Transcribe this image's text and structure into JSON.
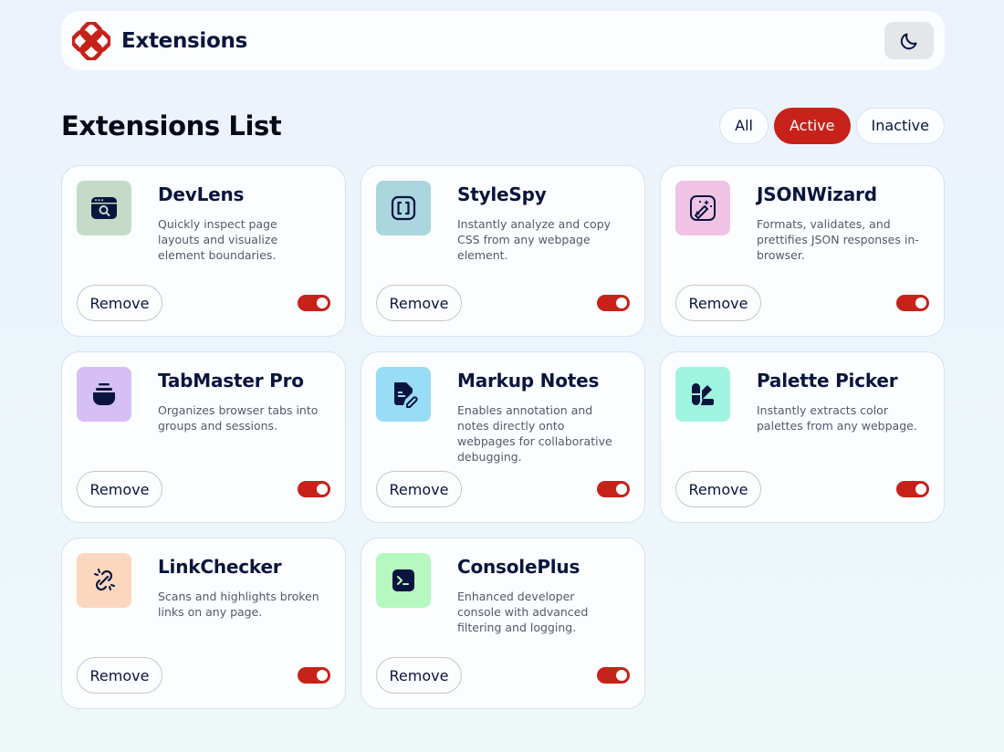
{
  "header": {
    "brand_name": "Extensions",
    "theme_toggle_icon": "moon-icon"
  },
  "list": {
    "title": "Extensions List",
    "filters": [
      {
        "label": "All",
        "active": false
      },
      {
        "label": "Active",
        "active": true
      },
      {
        "label": "Inactive",
        "active": false
      }
    ]
  },
  "extensions": [
    {
      "name": "DevLens",
      "description": "Quickly inspect page layouts and visualize element boundaries.",
      "icon": "browser-search-icon",
      "icon_bg": "#c4dcc7",
      "remove_label": "Remove",
      "enabled": true
    },
    {
      "name": "StyleSpy",
      "description": "Instantly analyze and copy CSS from any webpage element.",
      "icon": "brackets-icon",
      "icon_bg": "#abd6df",
      "remove_label": "Remove",
      "enabled": true
    },
    {
      "name": "JSONWizard",
      "description": "Formats, validates, and prettifies JSON responses in-browser.",
      "icon": "magic-wand-icon",
      "icon_bg": "#f0c3e5",
      "remove_label": "Remove",
      "enabled": true
    },
    {
      "name": "TabMaster Pro",
      "description": "Organizes browser tabs into groups and sessions.",
      "icon": "stack-icon",
      "icon_bg": "#d6bff2",
      "remove_label": "Remove",
      "enabled": true
    },
    {
      "name": "Markup Notes",
      "description": "Enables annotation and notes directly onto webpages for collaborative debugging.",
      "icon": "note-pen-icon",
      "icon_bg": "#99dcf5",
      "remove_label": "Remove",
      "enabled": true
    },
    {
      "name": "Palette Picker",
      "description": "Instantly extracts color palettes from any webpage.",
      "icon": "palette-icon",
      "icon_bg": "#9ff4e0",
      "remove_label": "Remove",
      "enabled": true
    },
    {
      "name": "LinkChecker",
      "description": "Scans and highlights broken links on any page.",
      "icon": "broken-link-icon",
      "icon_bg": "#fcd7c0",
      "remove_label": "Remove",
      "enabled": true
    },
    {
      "name": "ConsolePlus",
      "description": "Enhanced developer console with advanced filtering and logging.",
      "icon": "terminal-icon",
      "icon_bg": "#b5f8c0",
      "remove_label": "Remove",
      "enabled": true
    }
  ]
}
